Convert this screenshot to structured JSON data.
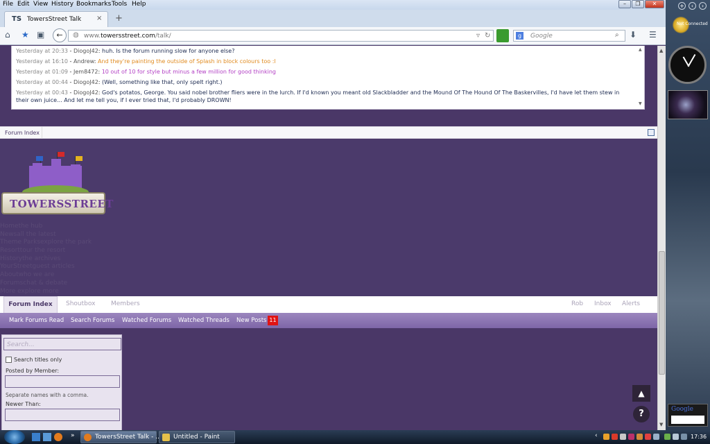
{
  "menubar": {
    "items": [
      "File",
      "Edit",
      "View",
      "History",
      "Bookmarks",
      "Tools",
      "Help"
    ]
  },
  "tab": {
    "favicon_text": "TS",
    "title": "TowersStreet Talk",
    "close": "×",
    "new": "+"
  },
  "url": {
    "prefix": "www.",
    "domain": "towersstreet.com",
    "path": "/talk/"
  },
  "search": {
    "placeholder": "Google"
  },
  "sidebar": {
    "status": "Not Connected",
    "google": "Google"
  },
  "shoutbox": {
    "messages": [
      {
        "time": "Yesterday at 20:33",
        "user": "DiogoJ42",
        "text": "huh. Is the forum running slow for anyone else?",
        "style": "dark"
      },
      {
        "time": "Yesterday at 16:10",
        "user": "Andrew",
        "text": "And they're painting the outside of Splash in block colours too :l",
        "style": "orange"
      },
      {
        "time": "Yesterday at 01:09",
        "user": "Jem8472",
        "text": "10 out of 10 for style but minus a few million for good thinking",
        "style": "purple"
      },
      {
        "time": "Yesterday at 00:44",
        "user": "DiogoJ42",
        "text": "(Well, something like that, only spelt right.)",
        "style": "dark"
      },
      {
        "time": "Yesterday at 00:43",
        "user": "DiogoJ42",
        "text": "God's potatos, George. You said nobel brother fliers were in the lurch. If I'd known you meant old Slackbladder and the Mound Of The Hound Of The Baskervilles, I'd have let them stew in their own juice... And let me tell you, if I ever tried that, I'd probably DROWN!",
        "style": "dark"
      }
    ]
  },
  "breadcrumb": {
    "label": "Forum Index"
  },
  "logo": {
    "text": "TOWERSSTREET"
  },
  "site_nav": [
    "Homethe hub",
    "Newsall the latest",
    "Theme Parksexplore the park",
    "Resorttour the resort",
    "Historythe archives",
    "YourStreetguest articles",
    "Aboutwho we are",
    "Forumschat & debate",
    "More explore more"
  ],
  "tabs": {
    "active": "Forum Index",
    "shoutbox": "Shoutbox",
    "members": "Members",
    "user": "Rob",
    "inbox": "Inbox",
    "alerts": "Alerts"
  },
  "subnav": {
    "mark_read": "Mark Forums Read",
    "search_forums": "Search Forums",
    "watched_forums": "Watched Forums",
    "watched_threads": "Watched Threads",
    "new_posts": "New Posts",
    "new_posts_count": "11"
  },
  "search_panel": {
    "placeholder": "Search...",
    "titles_only": "Search titles only",
    "posted_by": "Posted by Member:",
    "hint": "Separate names with a comma.",
    "newer_than": "Newer Than:"
  },
  "buttons": {
    "top": "▲",
    "help": "?"
  },
  "taskbar": {
    "task1": "TowersStreet Talk - ...",
    "task2": "Untitled - Paint",
    "time": "17:36",
    "more": "»"
  },
  "colors": {
    "page_bg": "#4b3a6b",
    "subnav": "#8e78b4",
    "badge": "#e01414"
  }
}
